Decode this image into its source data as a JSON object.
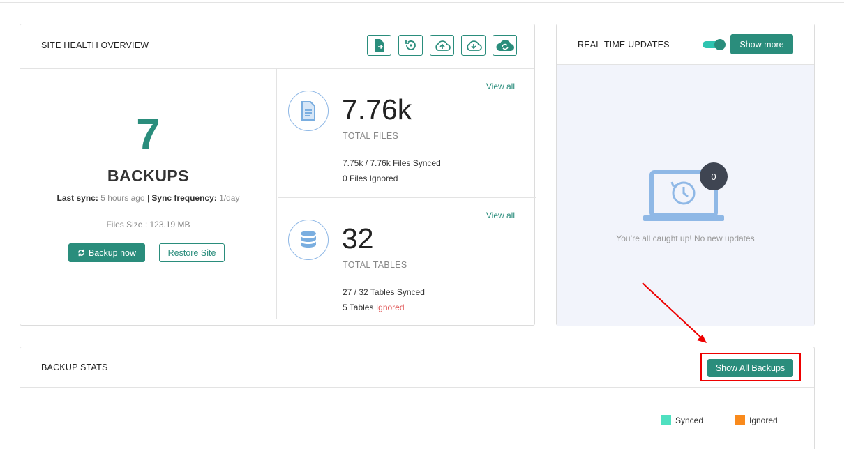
{
  "site_health": {
    "title": "SITE HEALTH OVERVIEW",
    "toolbar_icons": [
      "file-export-icon",
      "restore-icon",
      "cloud-upload-icon",
      "cloud-download-icon",
      "cloud-sync-icon"
    ],
    "backups_count": "7",
    "backups_label": "BACKUPS",
    "last_sync_label": "Last sync:",
    "last_sync_value": "5 hours ago",
    "separator": "|",
    "sync_freq_label": "Sync frequency:",
    "sync_freq_value": "1/day",
    "files_size": "Files Size : 123.19 MB",
    "backup_now_label": "Backup now",
    "restore_site_label": "Restore Site",
    "files": {
      "view_all": "View all",
      "count": "7.76k",
      "label": "TOTAL FILES",
      "synced": "7.75k / 7.76k Files Synced",
      "ignored": "0 Files Ignored"
    },
    "tables": {
      "view_all": "View all",
      "count": "32",
      "label": "TOTAL TABLES",
      "synced": "27 / 32 Tables Synced",
      "ignored_count": "5 Tables",
      "ignored_word": "Ignored"
    }
  },
  "realtime": {
    "title": "REAL-TIME UPDATES",
    "toggle_on": true,
    "show_more_label": "Show more",
    "badge_count": "0",
    "empty_message": "You’re all caught up! No new updates"
  },
  "backup_stats": {
    "title": "BACKUP STATS",
    "show_all_label": "Show All Backups",
    "legend": [
      {
        "label": "Synced",
        "color": "#4fe0c0"
      },
      {
        "label": "Ignored",
        "color": "#f98a1c"
      }
    ]
  },
  "colors": {
    "accent": "#2a8d7c",
    "annotation": "#ee0000"
  }
}
